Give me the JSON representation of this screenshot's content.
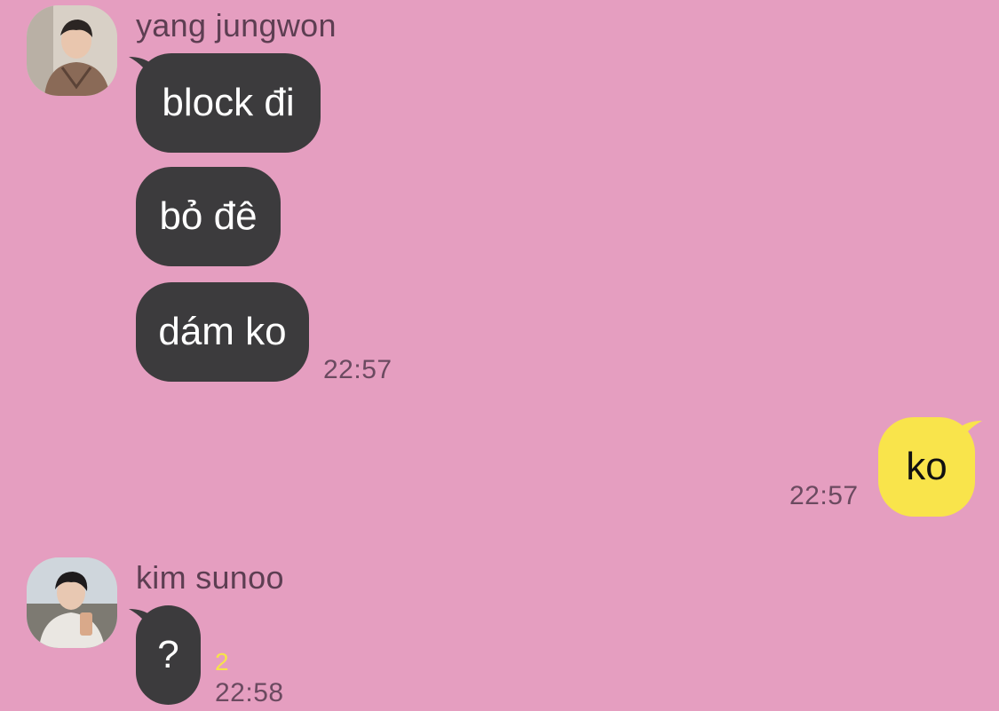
{
  "messages": [
    {
      "sender": "yang jungwon",
      "avatar": "avatar-photo",
      "bubbles": [
        "block đi",
        "bỏ đê",
        "dám ko"
      ],
      "time": "22:57"
    },
    {
      "mine": true,
      "bubbles": [
        "ko"
      ],
      "time": "22:57"
    },
    {
      "sender": "kim sunoo",
      "avatar": "avatar-photo",
      "bubbles": [
        "?"
      ],
      "unread": "2",
      "time": "22:58"
    }
  ],
  "colors": {
    "background": "#e59ec0",
    "incoming_bubble": "#3c3b3d",
    "outgoing_bubble": "#f9e44b",
    "unread_count": "#f7e34a"
  }
}
